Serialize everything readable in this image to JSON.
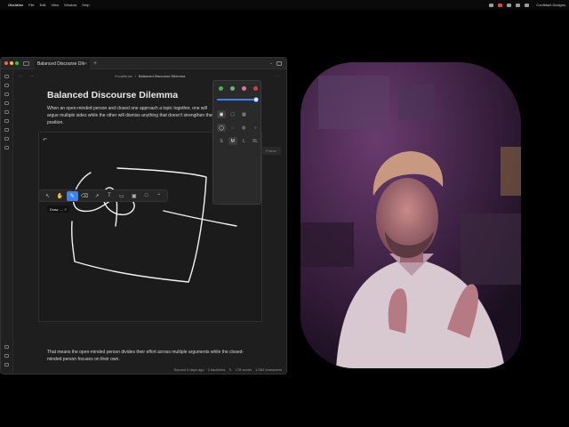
{
  "menubar": {
    "app_name": "Obsidian",
    "menus": [
      "File",
      "Edit",
      "View",
      "Window",
      "Help"
    ],
    "clock": "Confidant Designs"
  },
  "window": {
    "tab_title": "Balanced Discourse Dilemma",
    "tab_close": "×",
    "new_tab": "+",
    "breadcrumbs": [
      "Excalidraw",
      "/",
      "Balanced Discourse Dilemma"
    ],
    "nav_arrows": "← →",
    "more": "⋯"
  },
  "document": {
    "title": "Balanced Discourse Dilemma",
    "intro": "When an open-minded person and closed one approach a topic together, one will argue multiple sides while the other will dismiss anything that doesn't strengthen their position.",
    "closing": "That means the open-minded person divides their effort across multiple arguments while the closed-minded person focuses on their own."
  },
  "canvas": {
    "undo": "↶",
    "expand": "</>",
    "frame_label": "Frame",
    "tooltip_label": "Draw",
    "tooltip_key": "— P",
    "tools": [
      {
        "name": "select-tool",
        "glyph": "↖",
        "active": false
      },
      {
        "name": "hand-tool",
        "glyph": "✋",
        "active": false
      },
      {
        "name": "draw-tool",
        "glyph": "✎",
        "active": true
      },
      {
        "name": "eraser-tool",
        "glyph": "⌫",
        "active": false
      },
      {
        "name": "arrow-tool",
        "glyph": "↗",
        "active": false
      },
      {
        "name": "text-tool",
        "glyph": "T",
        "active": false
      },
      {
        "name": "note-tool",
        "glyph": "▭",
        "active": false
      },
      {
        "name": "image-tool",
        "glyph": "▣",
        "active": false
      },
      {
        "name": "rectangle-tool",
        "glyph": "□",
        "active": false
      },
      {
        "name": "more-tools",
        "glyph": "⌃",
        "active": false
      }
    ]
  },
  "style_panel": {
    "colors": [
      "#4caf50",
      "#66bb6a",
      "#e57399",
      "#e53935"
    ],
    "opacity": 1.0,
    "fill_options": [
      "▣",
      "▢",
      "▦"
    ],
    "dash_options": [
      "◯",
      "◌",
      "◍",
      "○"
    ],
    "sizes": [
      "S",
      "M",
      "L",
      "XL"
    ],
    "selected_size": "M"
  },
  "statusbar": {
    "synced": "Synced 4 days ago",
    "backlinks": "0 backlinks",
    "words": "178 words",
    "characters": "1,063 characters"
  }
}
